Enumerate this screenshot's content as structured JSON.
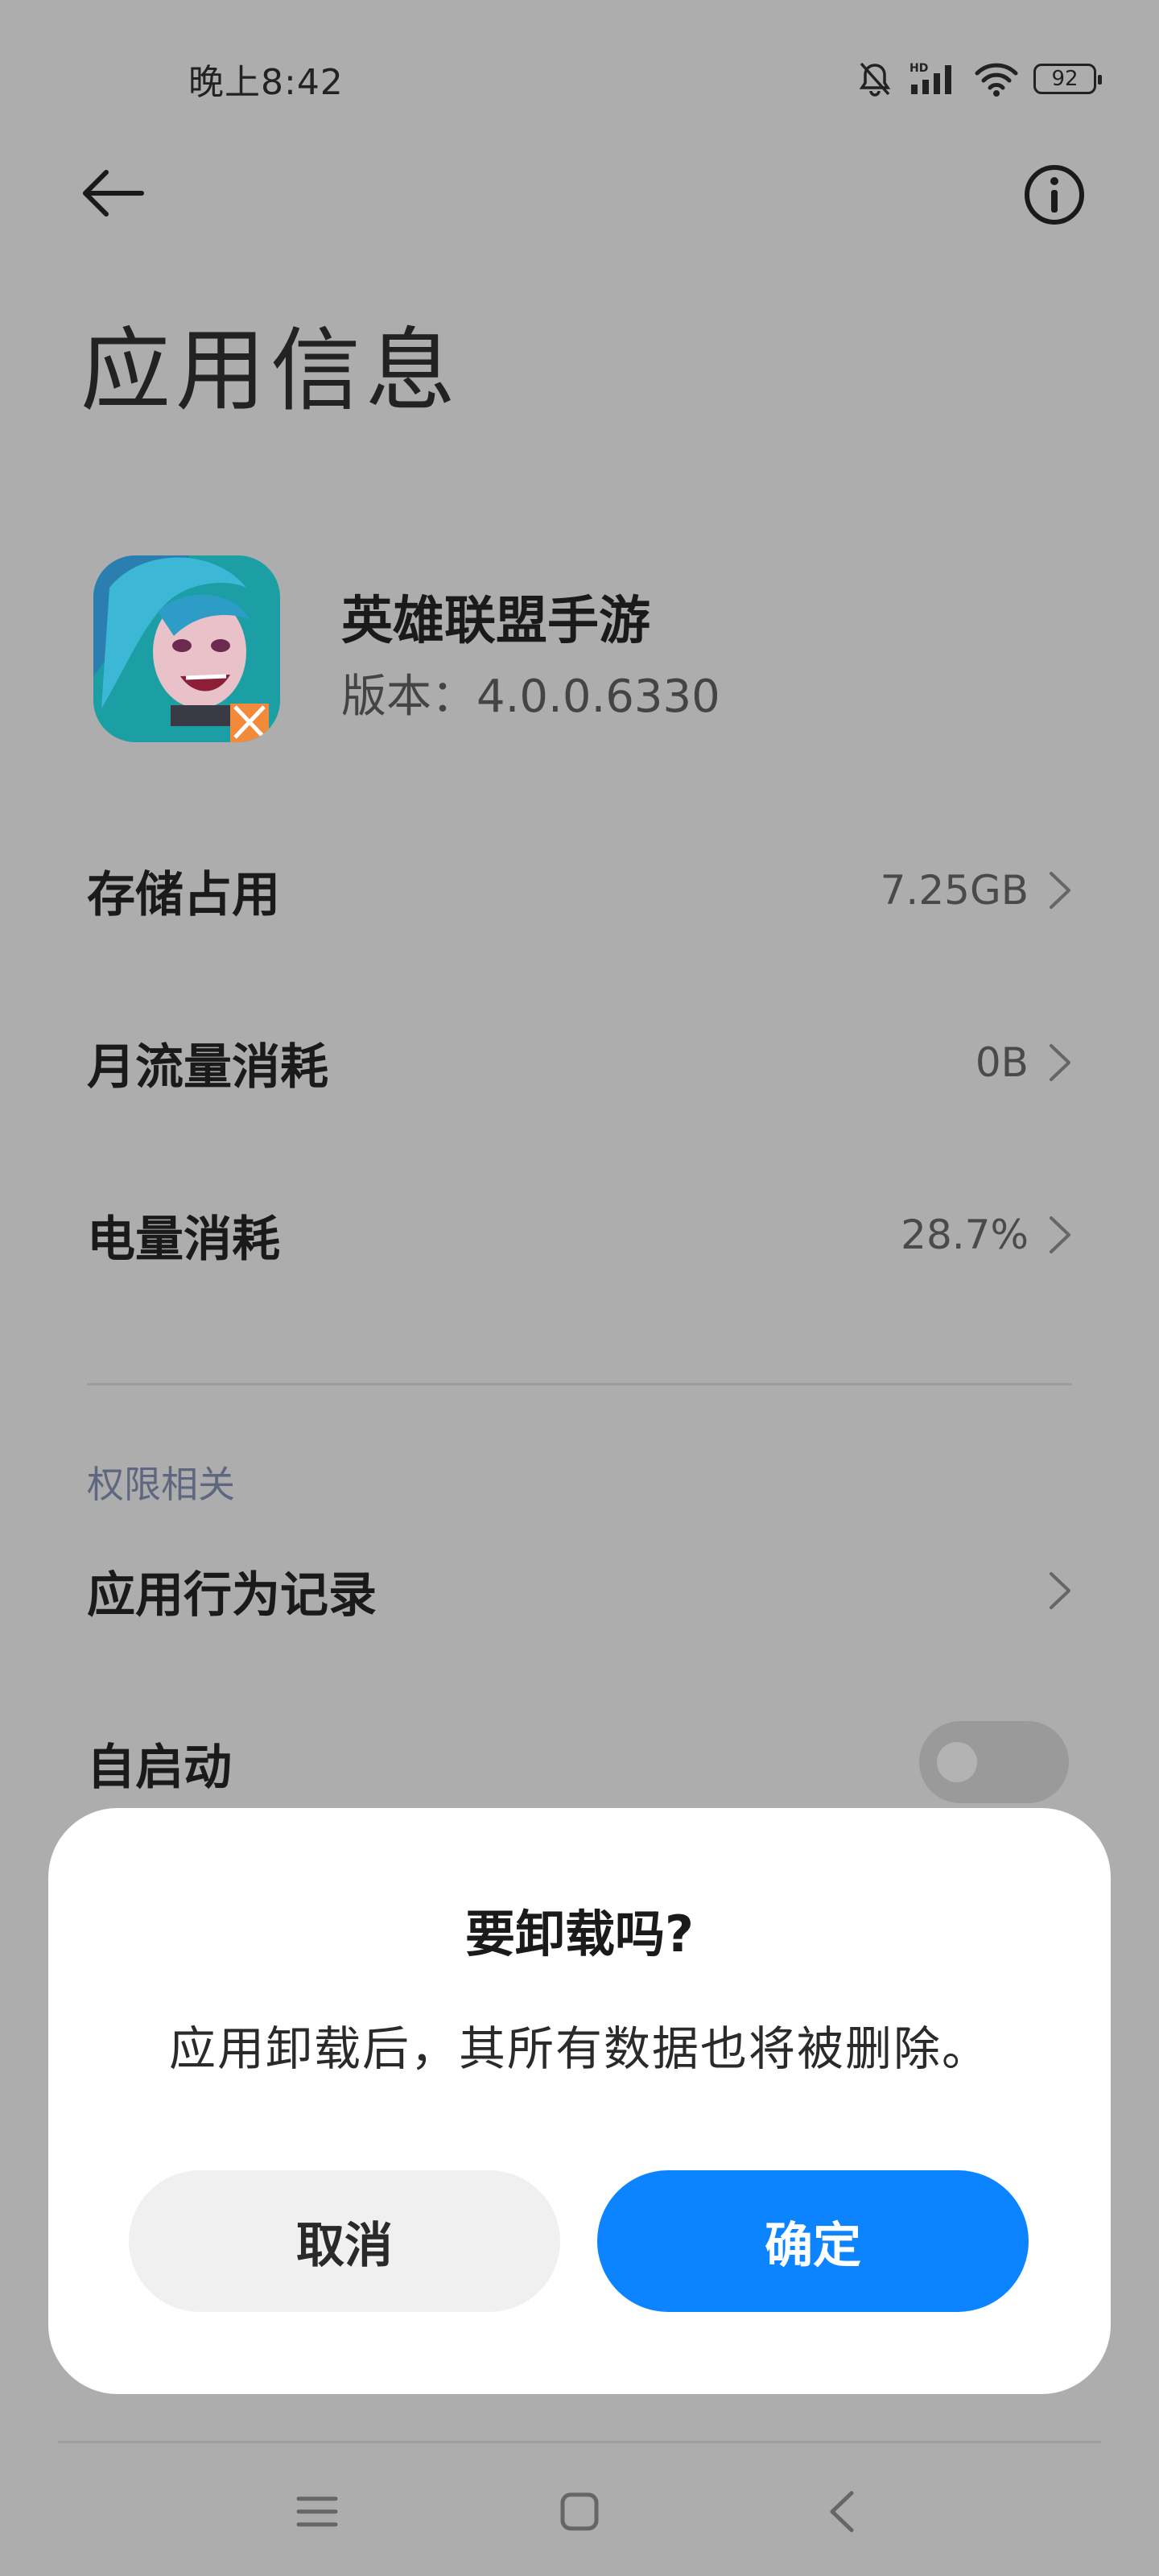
{
  "status_bar": {
    "time": "晚上8:42",
    "battery": "92",
    "icons": [
      "bell-muted-icon",
      "hd-signal-icon",
      "wifi-icon",
      "battery-icon"
    ]
  },
  "top_bar": {
    "back_icon": "arrow-left-icon",
    "info_icon": "info-icon"
  },
  "page": {
    "title": "应用信息"
  },
  "app": {
    "name": "英雄联盟手游",
    "version": "版本：4.0.0.6330"
  },
  "rows": [
    {
      "label": "存储占用",
      "value": "7.25GB"
    },
    {
      "label": "月流量消耗",
      "value": "0B"
    },
    {
      "label": "电量消耗",
      "value": "28.7%"
    }
  ],
  "permissions": {
    "section_label": "权限相关",
    "behavior_label": "应用行为记录",
    "autostart_label": "自启动",
    "autostart_on": false
  },
  "dialog": {
    "title": "要卸载吗?",
    "message": "应用卸载后，其所有数据也将被删除。",
    "cancel": "取消",
    "confirm": "确定"
  },
  "nav": {
    "icons": [
      "menu-icon",
      "home-icon",
      "back-icon"
    ]
  },
  "colors": {
    "background_dim": "#adadad",
    "dialog_bg": "#ffffff",
    "confirm": "#0d84ff",
    "cancel": "#f0f0f0"
  }
}
